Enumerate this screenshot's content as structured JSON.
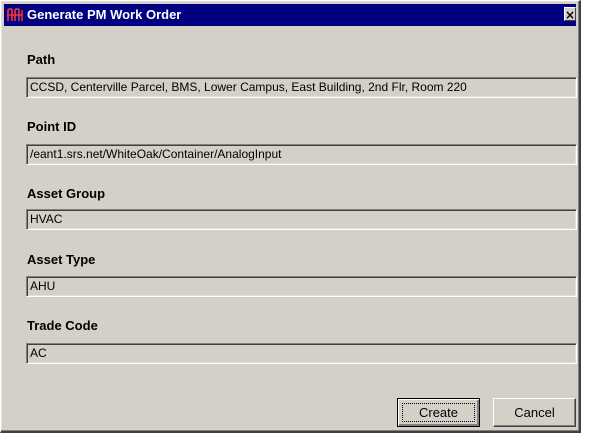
{
  "window": {
    "title": "Generate PM Work Order",
    "close_glyph": "×",
    "icon": "app-logo-icon"
  },
  "fields": {
    "path": {
      "label": "Path",
      "value": "CCSD, Centerville Parcel, BMS, Lower Campus, East  Building, 2nd Flr, Room 220"
    },
    "point_id": {
      "label": "Point ID",
      "value": "/eant1.srs.net/WhiteOak/Container/AnalogInput"
    },
    "asset_group": {
      "label": "Asset Group",
      "value": "HVAC"
    },
    "asset_type": {
      "label": "Asset Type",
      "value": "AHU"
    },
    "trade_code": {
      "label": "Trade Code",
      "value": "AC"
    }
  },
  "buttons": {
    "create": "Create",
    "cancel": "Cancel"
  },
  "colors": {
    "titlebar": "#000080",
    "face": "#d4d0c8",
    "icon_accent": "#cc0000"
  }
}
